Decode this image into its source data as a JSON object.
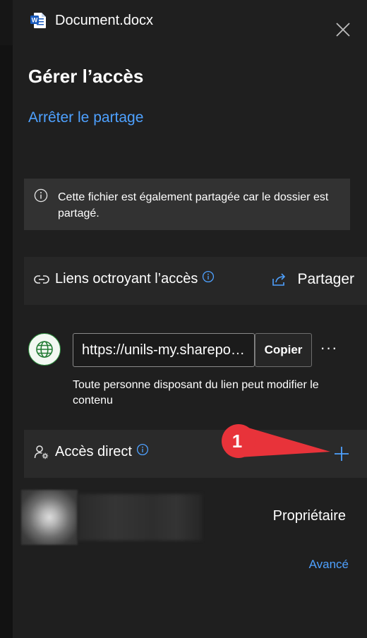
{
  "window": {
    "title": "Document.docx",
    "close_icon": "close-icon"
  },
  "dialog": {
    "heading": "Gérer l’accès",
    "stop_sharing_link": "Arrêter le partage"
  },
  "info_banner": {
    "text": "Cette fichier est également partagée car le dossier est partagé."
  },
  "links_section": {
    "label": "Liens octroyant l’accès",
    "share_label": "Partager"
  },
  "link": {
    "url": "https://unils-my.sharepoint.com/...",
    "copy_label": "Copier",
    "more_label": "···",
    "description": "Toute personne disposant du lien peut modifier le contenu"
  },
  "direct_access": {
    "label": "Accès direct"
  },
  "annotation": {
    "number": "1"
  },
  "user": {
    "role": "Propriétaire"
  },
  "footer": {
    "advanced_link": "Avancé"
  },
  "colors": {
    "accent": "#4ea1ff",
    "background": "#1f1f1f",
    "callout": "#e8333a",
    "word_blue": "#185abd"
  }
}
